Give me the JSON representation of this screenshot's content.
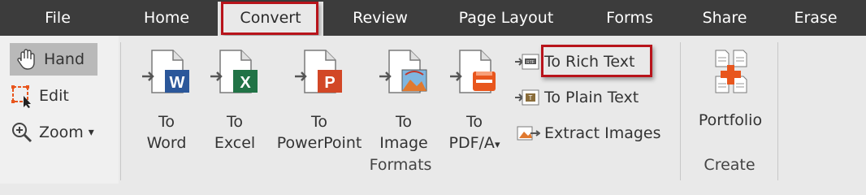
{
  "menubar": {
    "items": [
      "File",
      "Home",
      "Convert",
      "Review",
      "Page Layout",
      "Forms",
      "Share",
      "Erase"
    ]
  },
  "tools": {
    "hand": "Hand",
    "edit": "Edit",
    "zoom": "Zoom",
    "dropdown": "▾"
  },
  "formats": {
    "to_word": [
      "To",
      "Word"
    ],
    "to_excel": [
      "To",
      "Excel"
    ],
    "to_powerpoint": [
      "To",
      "PowerPoint"
    ],
    "to_image": [
      "To",
      "Image"
    ],
    "to_pdfa": [
      "To",
      "PDF/A"
    ],
    "to_rich_text": "To Rich Text",
    "to_plain_text": "To Plain Text",
    "extract_images": "Extract Images",
    "group_label": "Formats"
  },
  "create": {
    "portfolio": "Portfolio",
    "group_label": "Create"
  },
  "colors": {
    "menubar": "#3c3c3c",
    "highlight": "#b8141b",
    "word": "#2b579a",
    "excel": "#217346",
    "powerpoint": "#d24726",
    "pdfa": "#e8561d"
  }
}
